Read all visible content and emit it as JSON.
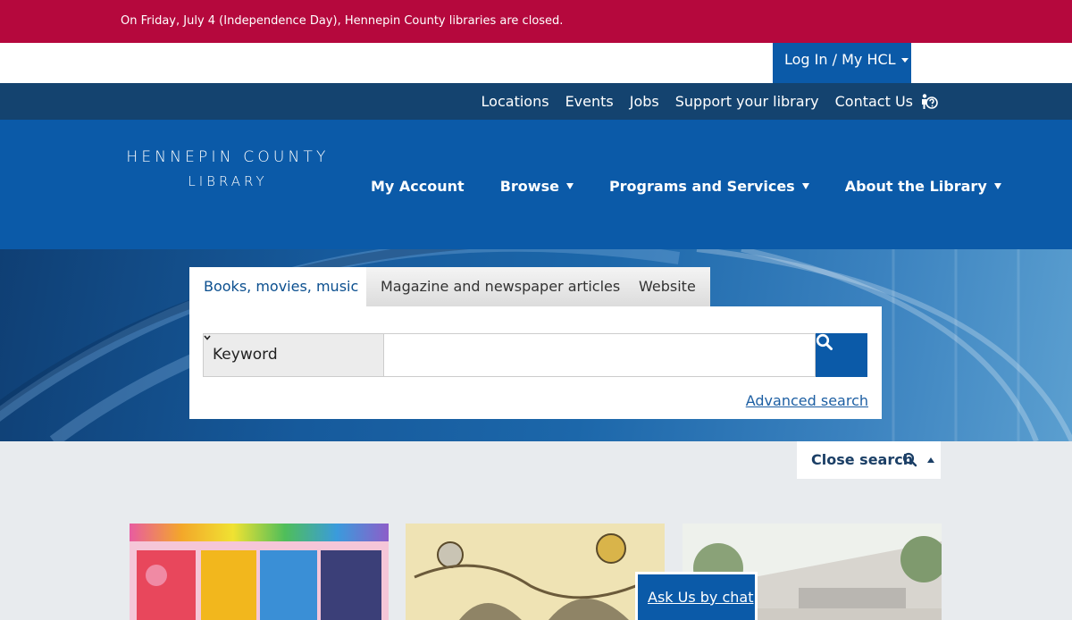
{
  "alert": {
    "text": "On Friday, July 4 (Independence Day), Hennepin County libraries are closed."
  },
  "account": {
    "login_label": "Log In / My HCL"
  },
  "utility_nav": [
    {
      "label": "Locations"
    },
    {
      "label": "Events"
    },
    {
      "label": "Jobs"
    },
    {
      "label": "Support your library"
    },
    {
      "label": "Contact Us"
    }
  ],
  "logo": {
    "line1": "HENNEPIN COUNTY",
    "line2": "LIBRARY"
  },
  "main_nav": [
    {
      "label": "My Account"
    },
    {
      "label": "Browse"
    },
    {
      "label": "Programs and Services"
    },
    {
      "label": "About the Library"
    }
  ],
  "search": {
    "tabs": [
      {
        "label": "Books, movies, music"
      },
      {
        "label": "Magazine and newspaper articles"
      },
      {
        "label": "Website"
      }
    ],
    "type_selected": "Keyword",
    "query_value": "",
    "advanced_label": "Advanced search",
    "close_label": "Close search"
  },
  "chat": {
    "label": "Ask Us by chat"
  },
  "colors": {
    "alert": "#b5083d",
    "brand_blue": "#0b5aa8",
    "nav_dark": "#14436f"
  },
  "icons": [
    "help-icon",
    "search-icon",
    "caret-down-icon",
    "caret-up-icon"
  ]
}
